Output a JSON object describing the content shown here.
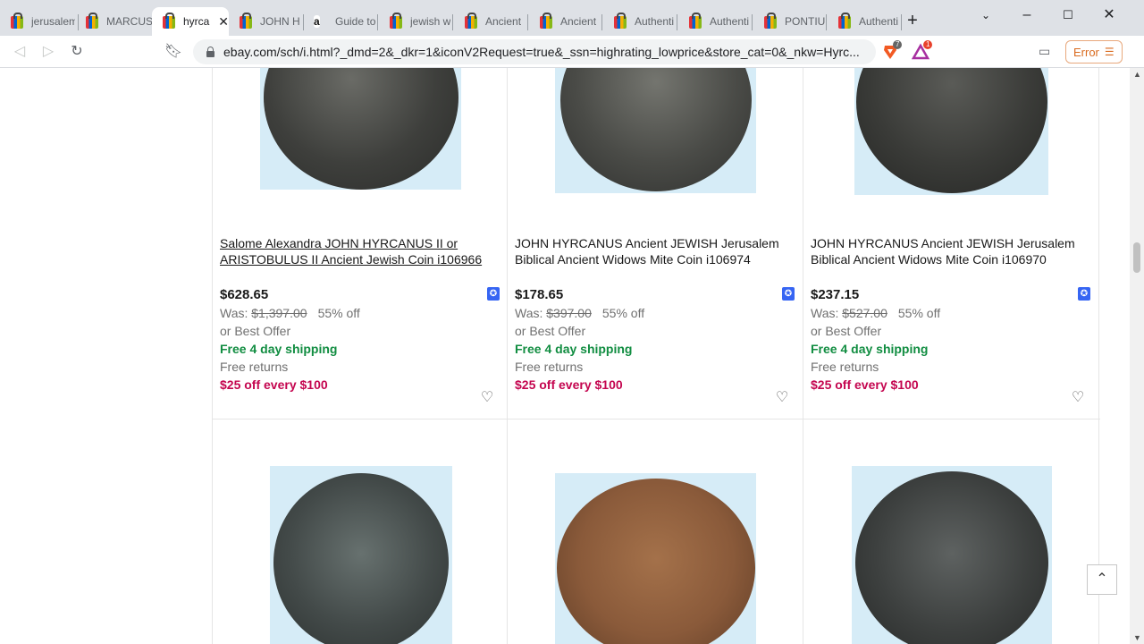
{
  "browser": {
    "tabs": [
      {
        "label": "jerusalem",
        "icon": "ebay-bag-icon"
      },
      {
        "label": "MARCUS",
        "icon": "ebay-bag-icon"
      },
      {
        "label": "hyrca",
        "icon": "ebay-bag-icon",
        "active": true
      },
      {
        "label": "JOHN H",
        "icon": "ebay-bag-icon"
      },
      {
        "label": "Guide to",
        "icon": "amazon-icon"
      },
      {
        "label": "jewish w",
        "icon": "ebay-bag-icon"
      },
      {
        "label": "Ancient",
        "icon": "ebay-bag-icon"
      },
      {
        "label": "Ancient",
        "icon": "ebay-bag-icon"
      },
      {
        "label": "Authenti",
        "icon": "ebay-bag-icon"
      },
      {
        "label": "Authenti",
        "icon": "ebay-bag-icon"
      },
      {
        "label": "PONTIU",
        "icon": "ebay-bag-icon"
      },
      {
        "label": "Authenti",
        "icon": "ebay-bag-icon"
      }
    ],
    "url": "ebay.com/sch/i.html?_dmd=2&_dkr=1&iconV2Request=true&_ssn=highrating_lowprice&store_cat=0&_nkw=Hyrc...",
    "error_label": "Error",
    "brave_shield_count": "7",
    "brave_rewards_count": "1"
  },
  "listings": [
    {
      "title": "Salome Alexandra JOHN HYRCANUS II or ARISTOBULUS II Ancient Jewish Coin i106966",
      "price": "$628.65",
      "was_label": "Was:",
      "was_price": "$1,397.00",
      "discount": "55% off",
      "best_offer": "or Best Offer",
      "shipping": "Free 4 day shipping",
      "returns": "Free returns",
      "promo": "$25 off every $100"
    },
    {
      "title": "JOHN HYRCANUS Ancient JEWISH Jerusalem Biblical Ancient Widows Mite Coin i106974",
      "price": "$178.65",
      "was_label": "Was:",
      "was_price": "$397.00",
      "discount": "55% off",
      "best_offer": "or Best Offer",
      "shipping": "Free 4 day shipping",
      "returns": "Free returns",
      "promo": "$25 off every $100"
    },
    {
      "title": "JOHN HYRCANUS Ancient JEWISH Jerusalem Biblical Ancient Widows Mite Coin i106970",
      "price": "$237.15",
      "was_label": "Was:",
      "was_price": "$527.00",
      "discount": "55% off",
      "best_offer": "or Best Offer",
      "shipping": "Free 4 day shipping",
      "returns": "Free returns",
      "promo": "$25 off every $100"
    }
  ],
  "colors": {
    "shipping": "#118d41",
    "promo": "#c4054f",
    "accent": "#3665f3"
  }
}
